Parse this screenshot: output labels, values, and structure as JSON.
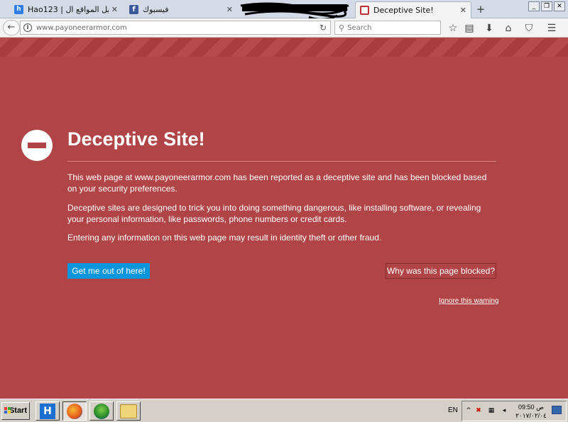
{
  "tabs": [
    {
      "label": "Hao123 | دليل المواقع ال...",
      "icon": "hao123-icon",
      "active": false
    },
    {
      "label": "فيسبوك",
      "icon": "facebook-icon",
      "active": false
    },
    {
      "label": "Deceptive Site!",
      "icon": "warning-icon",
      "active": true
    }
  ],
  "new_tab_label": "+",
  "nav": {
    "url": "www.payoneerarmor.com",
    "search_placeholder": "Search"
  },
  "page": {
    "title": "Deceptive Site!",
    "paragraphs": [
      "This web page at www.payoneerarmor.com has been reported as a deceptive site and has been blocked based on your security preferences.",
      "Deceptive sites are designed to trick you into doing something dangerous, like installing software, or revealing your personal information, like passwords, phone numbers or credit cards.",
      "Entering any information on this web page may result in identity theft or other fraud."
    ],
    "primary_button": "Get me out of here!",
    "secondary_button": "Why was this page blocked?",
    "ignore_link": "Ignore this warning"
  },
  "taskbar": {
    "start_label": "Start",
    "language": "EN",
    "clock_time": "09:50 ص",
    "clock_date": "٢٠١٧/٠٢/٠٤"
  },
  "colors": {
    "page_bg": "#b04446",
    "primary_button": "#0a96dc"
  }
}
